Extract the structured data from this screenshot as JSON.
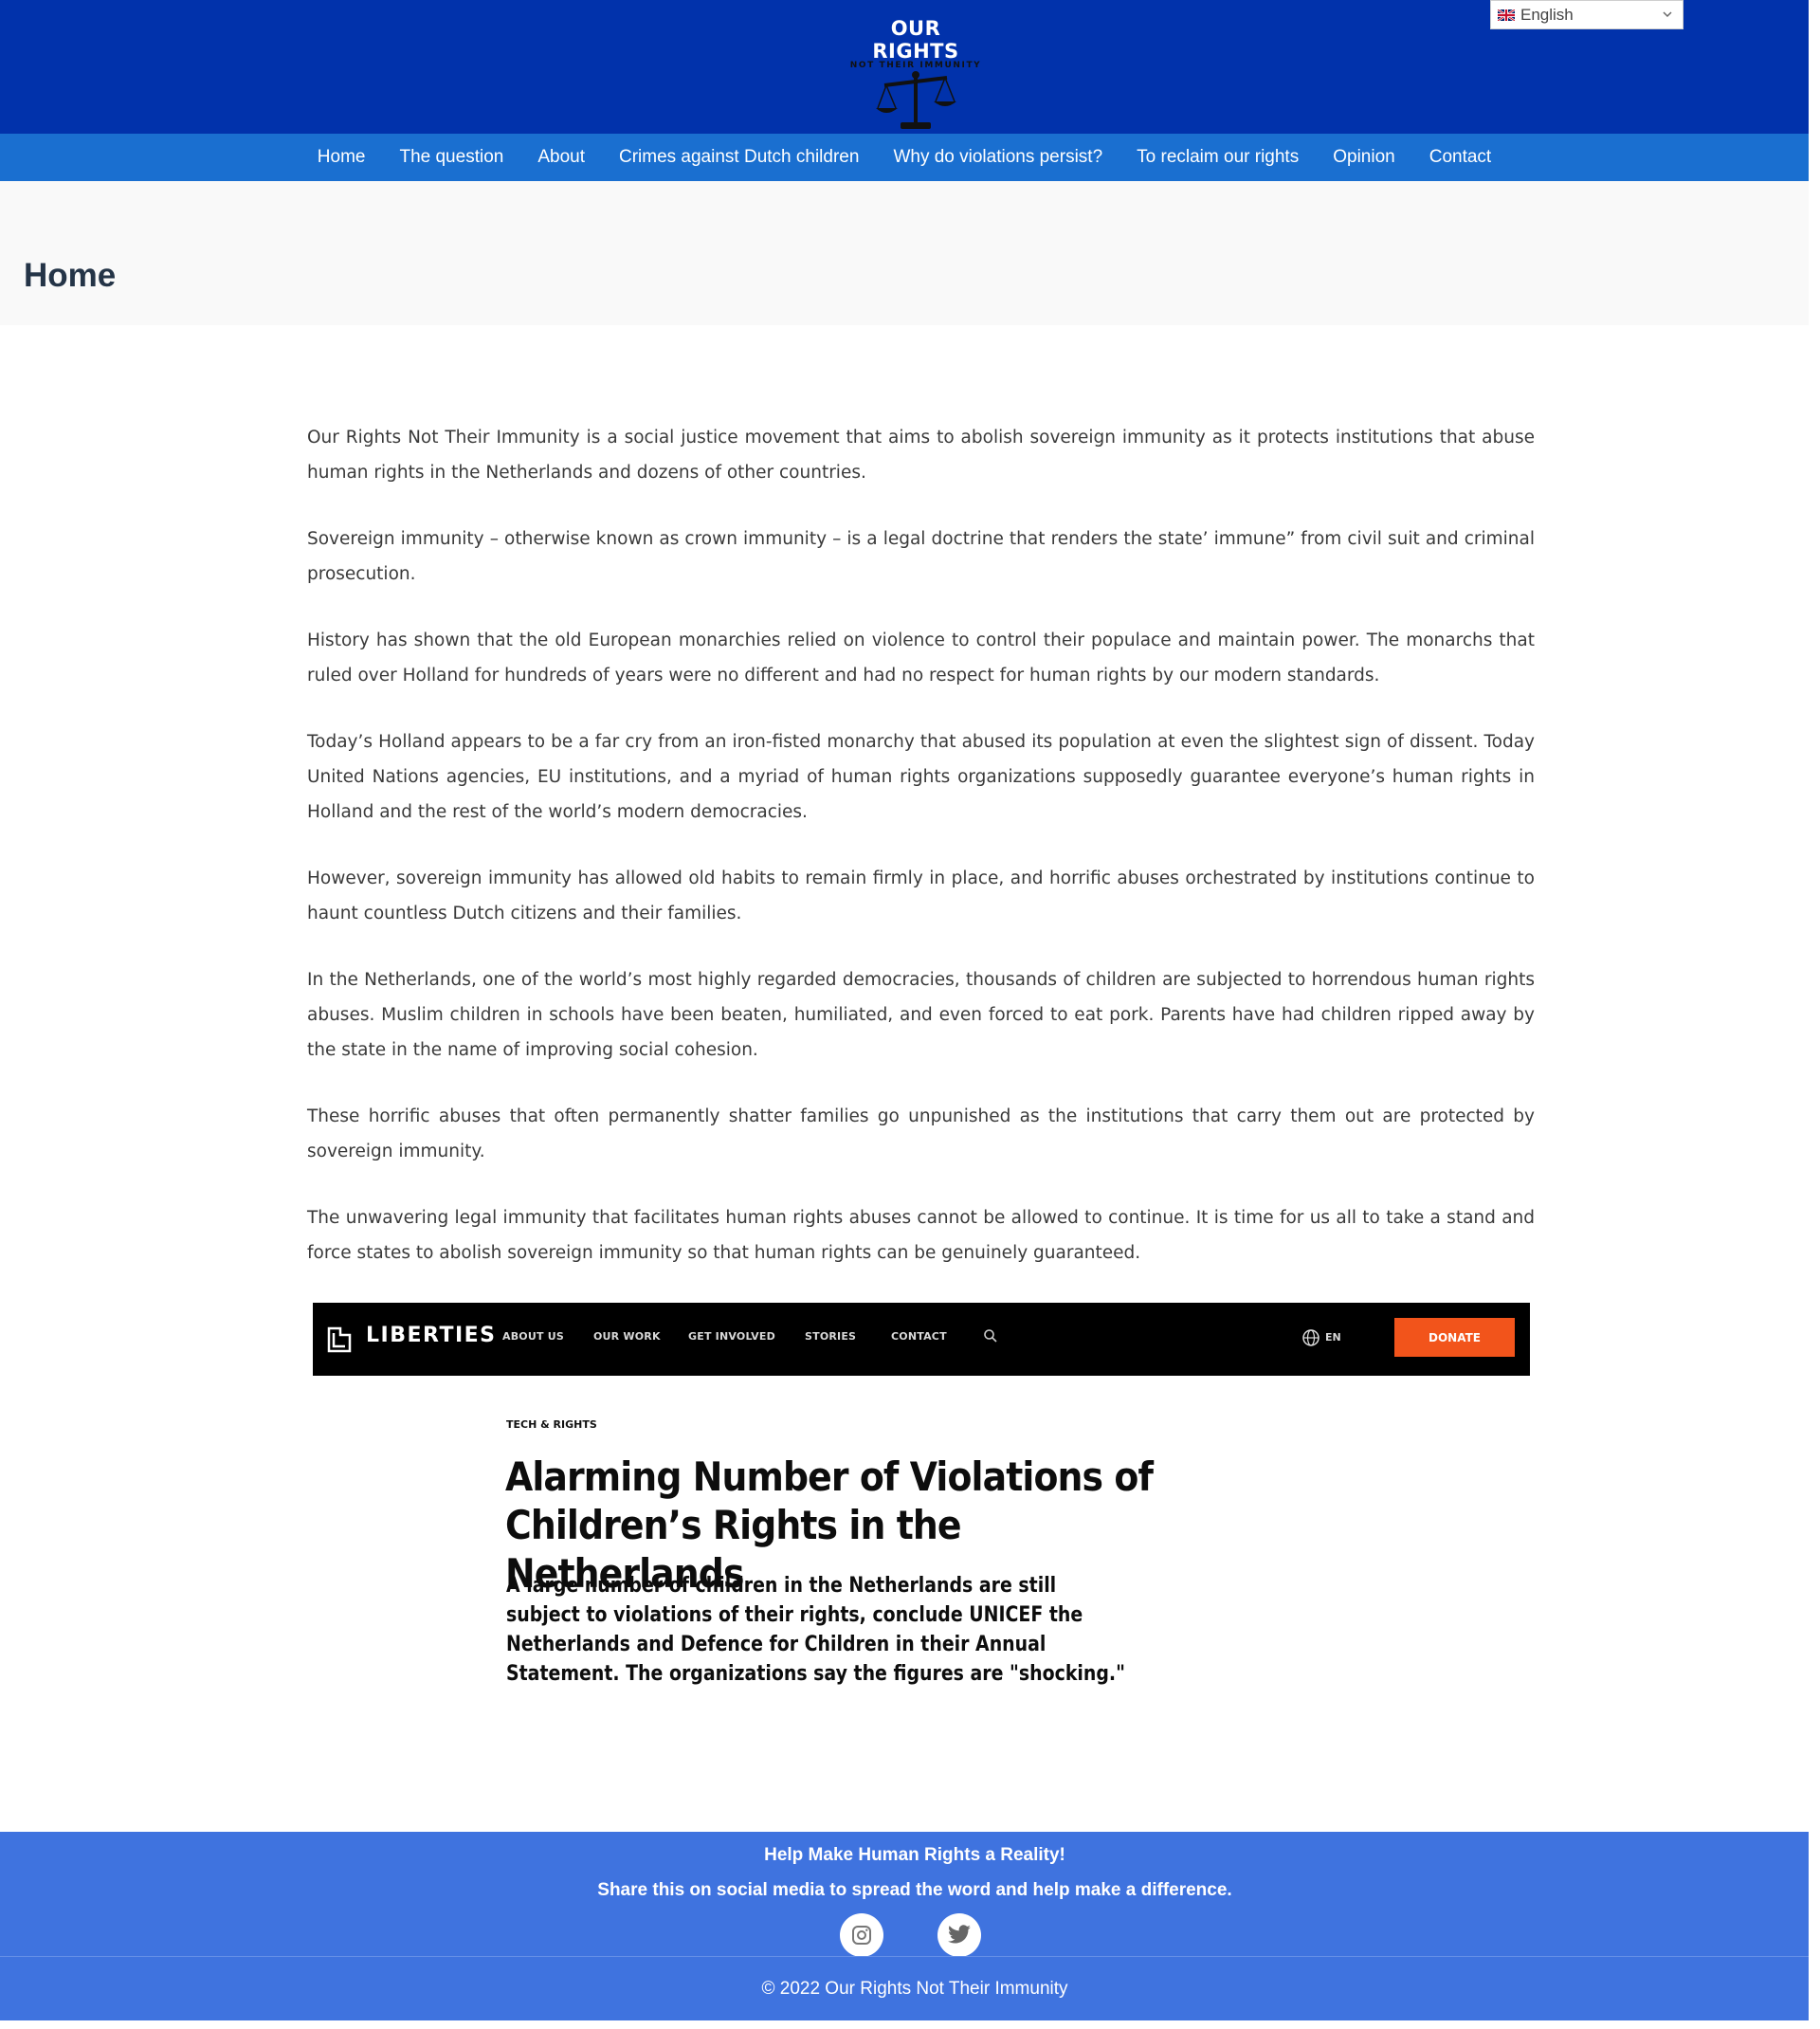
{
  "header": {
    "logo_title": "OUR RIGHTS",
    "logo_subtitle": "NOT THEIR IMMUNITY",
    "logo_icon": "scales-of-justice-icon",
    "language": {
      "selected": "English",
      "flag_icon": "uk-flag-icon"
    }
  },
  "nav": {
    "items": [
      {
        "label": "Home"
      },
      {
        "label": "The question"
      },
      {
        "label": "About"
      },
      {
        "label": "Crimes against Dutch children"
      },
      {
        "label": "Why do violations persist?"
      },
      {
        "label": "To reclaim our rights"
      },
      {
        "label": "Opinion"
      },
      {
        "label": "Contact"
      }
    ]
  },
  "page": {
    "title": "Home",
    "paragraphs": [
      "Our Rights Not Their Immunity is a social justice movement that aims to abolish sovereign immunity as it protects institutions that abuse human rights in the Netherlands and dozens of other countries.",
      "Sovereign immunity – otherwise known as crown immunity – is a legal doctrine that renders the state’ immune” from civil suit and criminal prosecution.",
      "History has shown that the old European monarchies relied on violence to control their populace and maintain power. The monarchs that ruled over Holland for hundreds of years were no different and had no respect for human rights by our modern standards.",
      "Today’s Holland appears to be a far cry from an iron-fisted monarchy that abused its population at even the slightest sign of dissent. Today United Nations agencies, EU institutions, and a myriad of human rights organizations supposedly guarantee everyone’s human rights in Holland and the rest of the world’s modern democracies.",
      "However, sovereign immunity has allowed old habits to remain firmly in place, and horrific abuses orchestrated by institutions continue to haunt countless Dutch citizens and their families.",
      "In the Netherlands, one of the world’s most highly regarded democracies, thousands of children are subjected to horrendous human rights abuses. Muslim children in schools have been beaten, humiliated, and even forced to eat pork. Parents have had children ripped away by the state in the name of improving social cohesion.",
      "These horrific abuses that often permanently shatter families go unpunished as the institutions that carry them out are protected by sovereign immunity.",
      "The unwavering legal immunity that facilitates human rights abuses cannot be allowed to continue. It is time for us all to take a stand and force states to abolish sovereign immunity so that human rights can be genuinely guaranteed."
    ]
  },
  "article_image": {
    "brand": "LIBERTIES",
    "menu": [
      "ABOUT US",
      "OUR WORK",
      "GET INVOLVED",
      "STORIES",
      "CONTACT"
    ],
    "lang": "EN",
    "donate": "DONATE",
    "kicker": "TECH & RIGHTS",
    "title": "Alarming Number of Violations of Children’s Rights in the Netherlands",
    "lede": "A large number of children in the Netherlands are still subject to violations of their rights, conclude UNICEF the Netherlands and Defence for Children in their Annual Statement. The organizations say the figures are \"shocking.\""
  },
  "footer": {
    "heading": "Help Make Human Rights a Reality!",
    "subheading": "Share this on social media to spread the word and help make a difference.",
    "social": [
      {
        "icon": "instagram-icon"
      },
      {
        "icon": "twitter-icon"
      }
    ],
    "copyright": "© 2022 Our Rights Not Their Immunity"
  },
  "colors": {
    "header_bg": "#0132ab",
    "nav_bg": "#1a6fd0",
    "footer_bg": "#3f73df",
    "donate": "#f2541b"
  }
}
